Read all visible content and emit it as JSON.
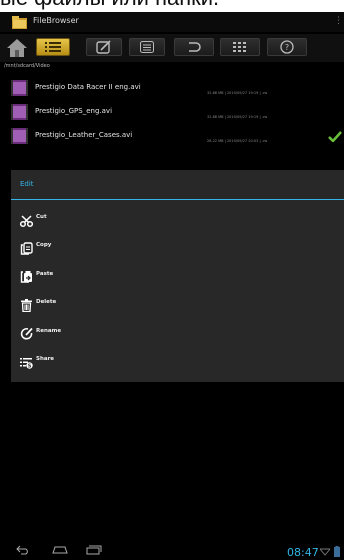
{
  "caption": "ые файлы или папки.",
  "app": {
    "title": "FileBrowser"
  },
  "path": "/mnt/sdcard/Video",
  "files": [
    {
      "name": "Prestigio Data Racer II eng.avi",
      "meta": "32.68 MB | 2010/09/27 19:19 | -rw"
    },
    {
      "name": "Prestigio_GPS_eng.avi",
      "meta": "32.88 MB | 2010/09/27 19:19 | -rw"
    },
    {
      "name": "Prestigio_Leather_Cases.avi",
      "meta": "28.22 MB | 2010/09/27 20:03 | -rw"
    }
  ],
  "dialog": {
    "title": "Edit",
    "items": [
      {
        "label": "Cut",
        "icon": "scissors-icon"
      },
      {
        "label": "Copy",
        "icon": "copy-icon"
      },
      {
        "label": "Paste",
        "icon": "paste-icon"
      },
      {
        "label": "Delete",
        "icon": "trash-icon"
      },
      {
        "label": "Rename",
        "icon": "rename-icon"
      },
      {
        "label": "Share",
        "icon": "share-icon"
      }
    ]
  },
  "status": {
    "time": "08:47"
  },
  "colors": {
    "accent": "#33b5e5",
    "toolbar_active": "#d4ac2a",
    "dialog_bg": "#282828",
    "check": "#6abf3a"
  }
}
